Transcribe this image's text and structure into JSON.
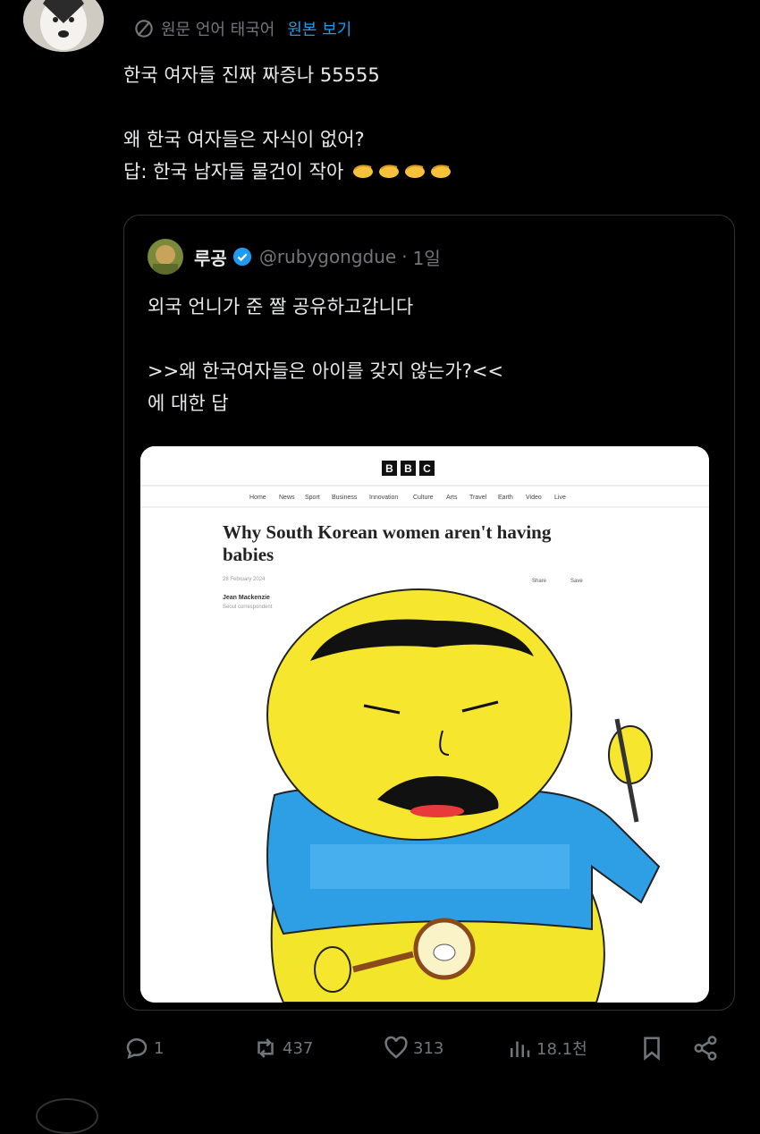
{
  "post": {
    "translate_label": "원문 언어 태국어",
    "show_original": "원본 보기",
    "text_line1": "한국 여자들 진짜 짜증나 55555",
    "text_line2": "왜 한국 여자들은 자식이 없어?",
    "text_line3": "답: 한국 남자들 물건이 작아",
    "emoji_name": "pinching-hand-emoji"
  },
  "quote": {
    "name": "루공",
    "handle": "@rubygongdue",
    "separator": "·",
    "time": "1일",
    "text_line1": "외국 언니가 준 짤 공유하고갑니다",
    "text_line2": ">>왜 한국여자들은 아이를 갖지 않는가?<<",
    "text_line3": "에 대한 답",
    "media": {
      "bbc_logo": [
        "B",
        "B",
        "C"
      ],
      "nav": [
        "Home",
        "News",
        "Sport",
        "Business",
        "Innovation",
        "Culture",
        "Arts",
        "Travel",
        "Earth",
        "Video",
        "Live"
      ],
      "headline_line1": "Why South Korean women aren't having",
      "headline_line2": "babies",
      "date": "28 February 2024",
      "share": "Share",
      "save": "Save",
      "author": "Jean Mackenzie",
      "author_role": "Seoul correspondent"
    }
  },
  "actions": {
    "replies": "1",
    "reposts": "437",
    "likes": "313",
    "views": "18.1천"
  },
  "colors": {
    "background": "#000000",
    "text": "#e7e9ea",
    "muted": "#71767b",
    "accent": "#1d9bf0",
    "border": "#2f3336"
  }
}
